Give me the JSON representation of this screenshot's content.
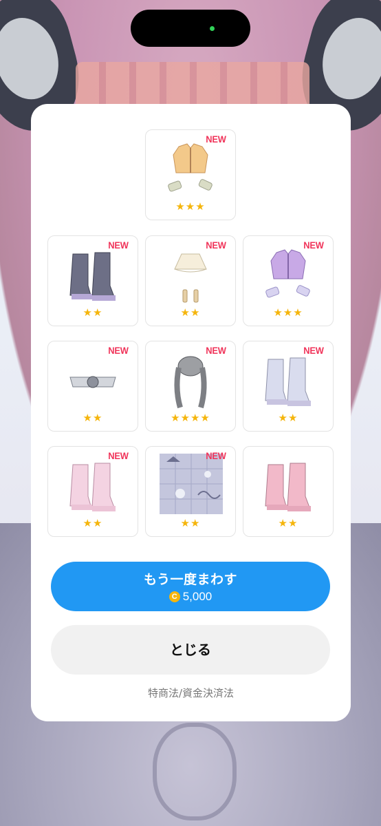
{
  "items": [
    {
      "name": "top",
      "new": "NEW",
      "stars": "★★★",
      "icon": "cropped-jacket-yellow"
    },
    {
      "name": "r1c1",
      "new": "NEW",
      "stars": "★★",
      "icon": "boots-dark"
    },
    {
      "name": "r1c2",
      "new": "NEW",
      "stars": "★★",
      "icon": "skirt-cream"
    },
    {
      "name": "r1c3",
      "new": "NEW",
      "stars": "★★★",
      "icon": "cropped-jacket-purple"
    },
    {
      "name": "r2c1",
      "new": "NEW",
      "stars": "★★",
      "icon": "belt-grey"
    },
    {
      "name": "r2c2",
      "new": "NEW",
      "stars": "★★★★",
      "icon": "twin-tail-hair-grey"
    },
    {
      "name": "r2c3",
      "new": "NEW",
      "stars": "★★",
      "icon": "boots-silver"
    },
    {
      "name": "r3c1",
      "new": "NEW",
      "stars": "★★",
      "icon": "boots-pink"
    },
    {
      "name": "r3c2",
      "new": "NEW",
      "stars": "★★",
      "icon": "pattern-background"
    },
    {
      "name": "r3c3",
      "new": "",
      "stars": "★★",
      "icon": "boots-rose"
    }
  ],
  "spin_again": {
    "label": "もう一度まわす",
    "coin_icon": "coin-icon",
    "coin_glyph": "C",
    "price": "5,000"
  },
  "close_button": {
    "label": "とじる"
  },
  "legal_link": "特商法/資金決済法",
  "colors": {
    "primary": "#2198f3",
    "new_badge": "#f0345a",
    "star": "#f5b50c"
  }
}
